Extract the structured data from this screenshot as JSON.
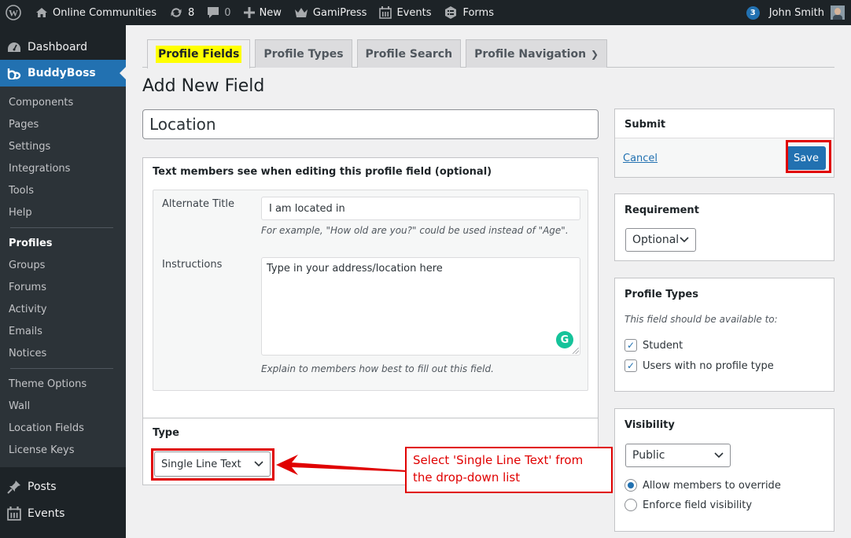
{
  "adminbar": {
    "site_name": "Online Communities",
    "updates_count": "8",
    "comments_count": "0",
    "new_label": "New",
    "gamipress_label": "GamiPress",
    "events_label": "Events",
    "forms_label": "Forms",
    "notifications_count": "3",
    "user_name": "John Smith"
  },
  "sidebar": {
    "dashboard": "Dashboard",
    "buddyboss": "BuddyBoss",
    "submenu_group1": [
      "Components",
      "Pages",
      "Settings",
      "Integrations",
      "Tools",
      "Help"
    ],
    "submenu_group2": [
      "Profiles",
      "Groups",
      "Forums",
      "Activity",
      "Emails",
      "Notices"
    ],
    "submenu_group3": [
      "Theme Options",
      "Wall",
      "Location Fields",
      "License Keys"
    ],
    "active_item": "Profiles",
    "posts": "Posts",
    "events": "Events"
  },
  "tabs": [
    {
      "label": "Profile Fields",
      "active": true
    },
    {
      "label": "Profile Types",
      "active": false
    },
    {
      "label": "Profile Search",
      "active": false
    },
    {
      "label": "Profile Navigation",
      "active": false
    }
  ],
  "page_title": "Add New Field",
  "field_name_value": "Location",
  "description_panel": {
    "title": "Text members see when editing this profile field (optional)",
    "alternate_title_label": "Alternate Title",
    "alternate_title_value": "I am located in",
    "alternate_title_hint": "For example, \"How old are you?\" could be used instead of \"Age\".",
    "instructions_label": "Instructions",
    "instructions_value": "Type in your address/location here",
    "instructions_hint": "Explain to members how best to fill out this field."
  },
  "type_panel": {
    "title": "Type",
    "selected": "Single Line Text"
  },
  "annotation": {
    "text": "Select 'Single Line Text' from the drop-down list",
    "color": "#e00000"
  },
  "submit_panel": {
    "title": "Submit",
    "cancel_label": "Cancel",
    "save_label": "Save"
  },
  "requirement_panel": {
    "title": "Requirement",
    "selected": "Optional"
  },
  "profile_types_panel": {
    "title": "Profile Types",
    "note": "This field should be available to:",
    "options": [
      {
        "label": "Student",
        "checked": true
      },
      {
        "label": "Users with no profile type",
        "checked": true
      }
    ]
  },
  "visibility_panel": {
    "title": "Visibility",
    "selected": "Public",
    "options": [
      {
        "label": "Allow members to override",
        "selected": true
      },
      {
        "label": "Enforce field visibility",
        "selected": false
      }
    ]
  },
  "colors": {
    "accent": "#2271b1",
    "highlight": "#ffff00",
    "annotation_red": "#e00000"
  }
}
